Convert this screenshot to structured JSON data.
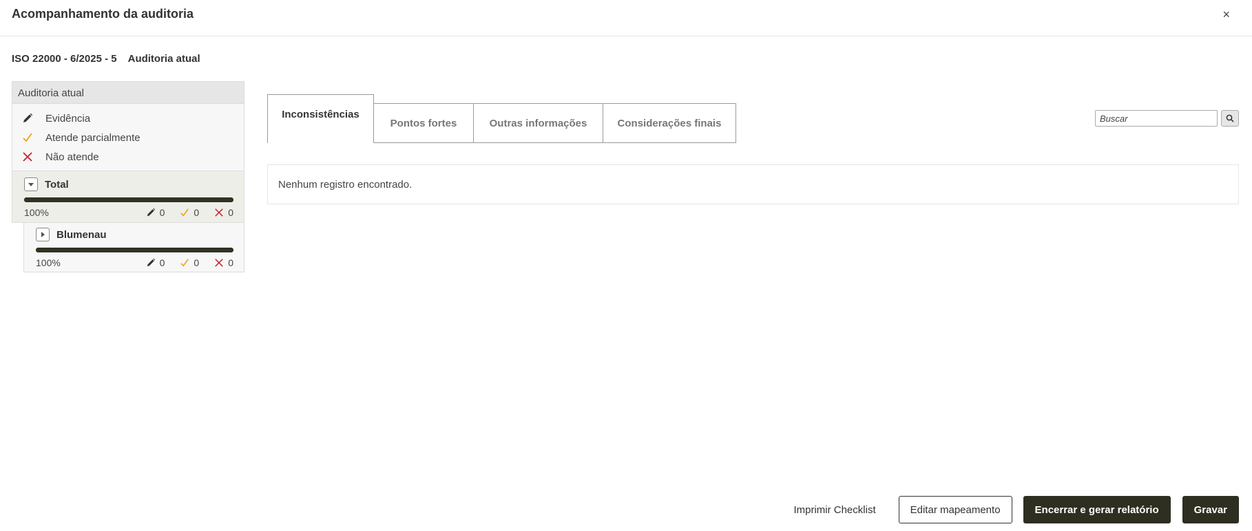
{
  "dialog": {
    "title": "Acompanhamento da auditoria",
    "close_label": "×"
  },
  "subtitle": {
    "code": "ISO 22000 - 6/2025 - 5",
    "label": "Auditoria atual"
  },
  "panel": {
    "header": "Auditoria atual",
    "legend": [
      {
        "icon": "pencil-icon",
        "label": "Evidência"
      },
      {
        "icon": "check-icon",
        "label": "Atende parcialmente"
      },
      {
        "icon": "x-icon",
        "label": "Não atende"
      }
    ],
    "nodes": [
      {
        "name": "Total",
        "expanded": true,
        "progress": 1.0,
        "percent_label": "100%",
        "evidence": "0",
        "partial": "0",
        "fail": "0"
      },
      {
        "name": "Blumenau",
        "expanded": false,
        "progress": 1.0,
        "percent_label": "100%",
        "evidence": "0",
        "partial": "0",
        "fail": "0"
      }
    ]
  },
  "tabs": [
    {
      "label": "Inconsistências",
      "active": true
    },
    {
      "label": "Pontos fortes",
      "active": false
    },
    {
      "label": "Outras informações",
      "active": false
    },
    {
      "label": "Considerações finais",
      "active": false
    }
  ],
  "search": {
    "placeholder": "Buscar",
    "value": ""
  },
  "results": {
    "empty_message": "Nenhum registro encontrado."
  },
  "footer": {
    "print_label": "Imprimir Checklist",
    "edit_label": "Editar mapeamento",
    "close_report_label": "Encerrar e gerar relatório",
    "save_label": "Gravar"
  },
  "colors": {
    "pencil": "#333333",
    "check": "#f0a30a",
    "x": "#cc1f2f",
    "progress": "#323223",
    "button_dark": "#2e2e21"
  }
}
